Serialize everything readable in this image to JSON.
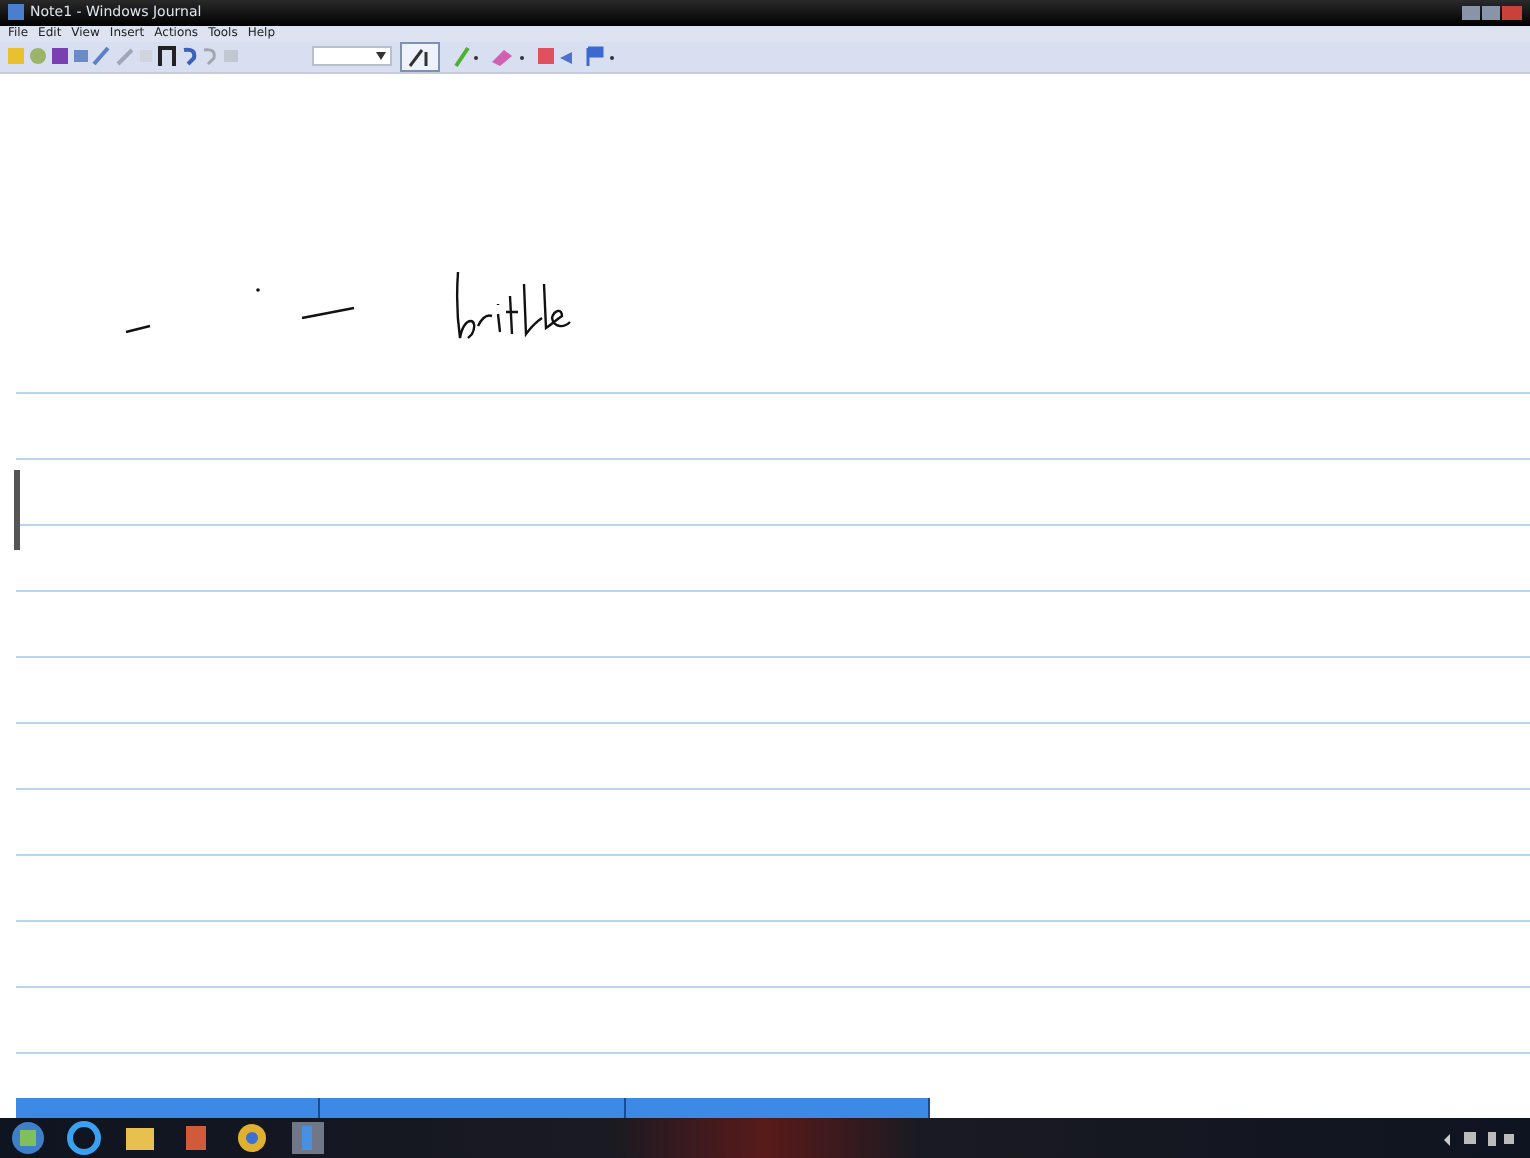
{
  "window": {
    "title": "Note1 - Windows Journal"
  },
  "menu": [
    "File",
    "Edit",
    "View",
    "Insert",
    "Actions",
    "Tools",
    "Help"
  ],
  "toolbar": {
    "pen_selected": true
  }
}
